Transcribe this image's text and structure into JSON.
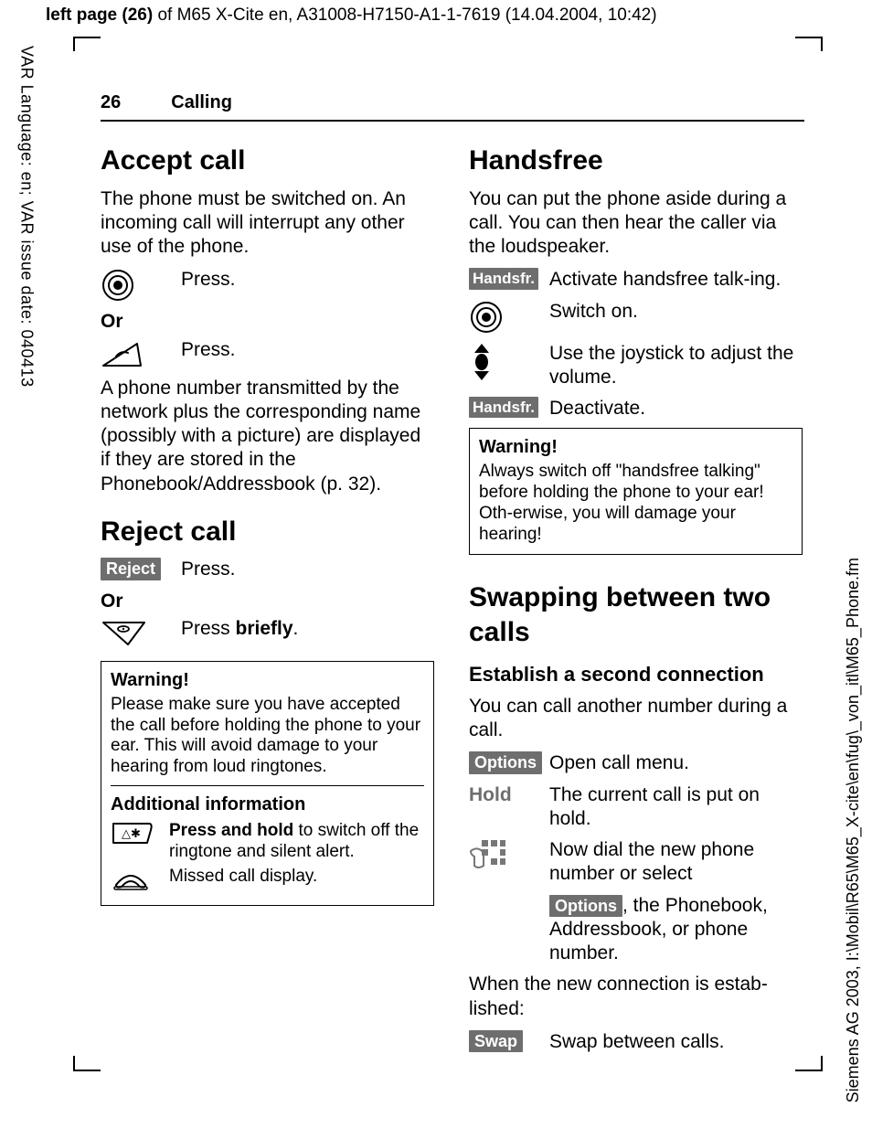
{
  "meta": {
    "top_bold": "left page (26)",
    "top_rest": " of M65 X-Cite en, A31008-H7150-A1-1-7619 (14.04.2004, 10:42)",
    "side_left": "VAR Language: en; VAR issue date: 040413",
    "side_right": "Siemens AG 2003, I:\\Mobil\\R65\\M65_X-cite\\en\\fug\\_von_itl\\M65_Phone.fm"
  },
  "header": {
    "page_num": "26",
    "section": "Calling"
  },
  "left": {
    "h_accept": "Accept call",
    "accept_intro": "The phone must be switched on. An incoming call will interrupt any other use of the phone.",
    "press": "Press.",
    "or": "Or",
    "accept_detail": "A phone number transmitted by the network plus the corresponding name (possibly with a picture) are displayed if they are stored in the Phonebook/Addressbook (p. 32).",
    "h_reject": "Reject call",
    "reject_key": "Reject",
    "press_briefly_pre": "Press ",
    "press_briefly_bold": "briefly",
    "press_briefly_post": ".",
    "warn_title": "Warning!",
    "warn_body": "Please make sure you have accepted the call before holding the phone to your ear. This will avoid damage to your hearing from loud ringtones.",
    "addl_title": "Additional information",
    "addl_row1_bold": "Press and hold",
    "addl_row1_rest": " to switch off the ringtone and silent alert.",
    "addl_row2": "Missed call display."
  },
  "right": {
    "h_hands": "Handsfree",
    "hands_intro": "You can put the phone aside during a call. You can then hear the caller via the loudspeaker.",
    "handsfr_key": "Handsfr.",
    "activate": "Activate handsfree talk-ing.",
    "switch_on": "Switch on.",
    "joy": "Use the joystick to adjust the volume.",
    "deactivate": "Deactivate.",
    "warn_title": "Warning!",
    "warn_body": "Always switch off \"handsfree talking\" before holding the phone to your ear! Oth-erwise, you will damage your hearing!",
    "h_swap": "Swapping between two calls",
    "h_establish": "Establish a second connection",
    "establish_intro": "You can call another number during a call.",
    "options_key": "Options",
    "open_menu": "Open call menu.",
    "hold_label": "Hold",
    "hold_desc": "The current call is put on hold.",
    "dial_desc": "Now dial the new phone number or select",
    "dial_cont": ", the Phonebook, Addressbook, or phone number.",
    "when_est": "When the new connection is estab-lished:",
    "swap_key": "Swap",
    "swap_desc": "Swap between calls."
  }
}
